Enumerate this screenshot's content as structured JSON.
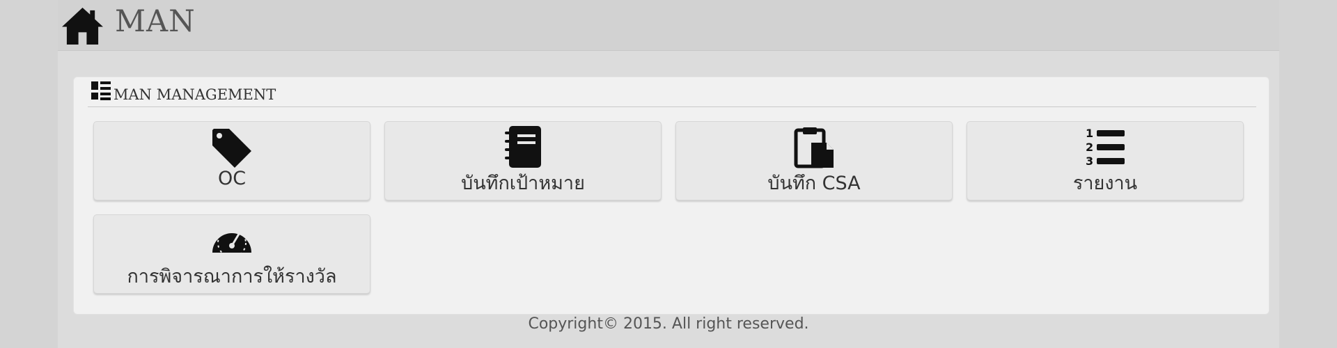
{
  "header": {
    "title": "MAN",
    "icon": "home-icon"
  },
  "panel": {
    "title": "MAN MANAGEMENT",
    "icon": "list-layout-icon"
  },
  "tiles": [
    {
      "label": "OC",
      "icon": "tag-icon"
    },
    {
      "label": "บันทึกเป้าหมาย",
      "icon": "notebook-icon"
    },
    {
      "label": "บันทึก CSA",
      "icon": "clipboard-icon"
    },
    {
      "label": "รายงาน",
      "icon": "numbered-list-icon"
    },
    {
      "label": "การพิจารณาการให้รางวัล",
      "icon": "speedometer-icon"
    }
  ],
  "footer": {
    "copyright": "Copyright© 2015. All right reserved."
  },
  "colors": {
    "background": "#d4d4d4",
    "page": "#dcdcdc",
    "panel": "#f1f1f1",
    "tile": "#e8e8e8",
    "icon": "#111111"
  }
}
